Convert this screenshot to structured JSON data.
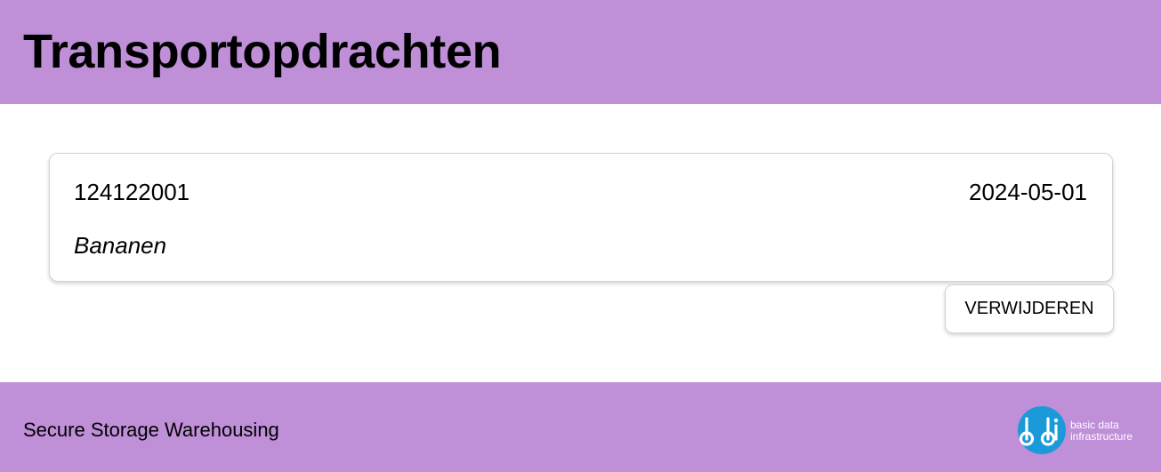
{
  "header": {
    "title": "Transportopdrachten",
    "background_color": "#bf8fd8"
  },
  "order": {
    "number": "124122001",
    "date": "2024-05-01",
    "product": "Bananen"
  },
  "actions": {
    "delete_label": "VERWIJDEREN"
  },
  "footer": {
    "text": "Secure Storage Warehousing",
    "logo": {
      "mark": "bdi",
      "tagline_line1": "basic data",
      "tagline_line2": "infrastructure",
      "color": "#1a9ad9"
    }
  }
}
